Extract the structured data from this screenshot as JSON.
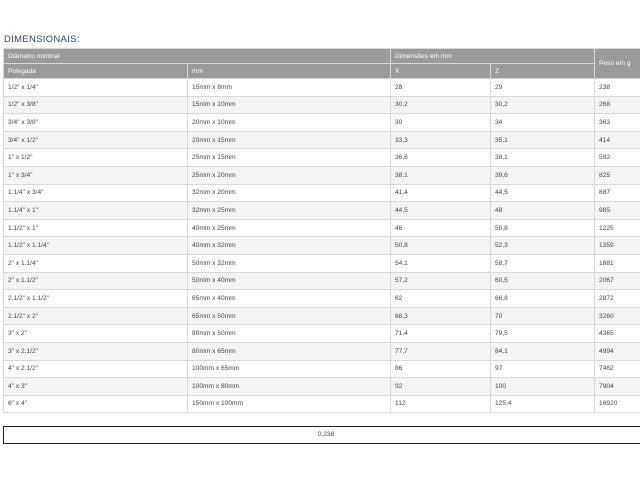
{
  "title": "DIMENSIONAIS:",
  "headers": {
    "diametro": "Diâmetro nominal",
    "dimensoes": "Dimensões em mm",
    "peso": "Peso em g",
    "polegada": "Polegada",
    "mm": "mm",
    "x": "X",
    "z": "Z"
  },
  "rows": [
    {
      "pol": "1/2\" x 1/4\"",
      "mm": "15mm x 8mm",
      "x": "28",
      "z": "29",
      "peso": "238"
    },
    {
      "pol": "1/2\" x 3/8\"",
      "mm": "15mm x 10mm",
      "x": "30,2",
      "z": "30,2",
      "peso": "268"
    },
    {
      "pol": "3/4\" x 3/8\"",
      "mm": "20mm x 10mm",
      "x": "30",
      "z": "34",
      "peso": "363"
    },
    {
      "pol": "3/4\" x 1/2\"",
      "mm": "20mm x 15mm",
      "x": "33,3",
      "z": "35,1",
      "peso": "414"
    },
    {
      "pol": "1\" x 1/2\"",
      "mm": "25mm x 15mm",
      "x": "36,6",
      "z": "38,1",
      "peso": "592"
    },
    {
      "pol": "1\" x 3/4\"",
      "mm": "25mm x 20mm",
      "x": "38,1",
      "z": "39,6",
      "peso": "825"
    },
    {
      "pol": "1.1/4\" x 3/4\"",
      "mm": "32mm x 20mm",
      "x": "41,4",
      "z": "44,5",
      "peso": "887"
    },
    {
      "pol": "1.1/4\" x 1\"",
      "mm": "32mm x 25mm",
      "x": "44,5",
      "z": "48",
      "peso": "985"
    },
    {
      "pol": "1.1/2\" x 1\"",
      "mm": "40mm x 25mm",
      "x": "46",
      "z": "50,8",
      "peso": "1225"
    },
    {
      "pol": "1.1/2\" x 1.1/4\"",
      "mm": "40mm x 32mm",
      "x": "50,8",
      "z": "52,3",
      "peso": "1359"
    },
    {
      "pol": "2\" x 1.1/4\"",
      "mm": "50mm x 32mm",
      "x": "54,1",
      "z": "58,7",
      "peso": "1881"
    },
    {
      "pol": "2\" x 1.1/2\"",
      "mm": "50mm x 40mm",
      "x": "57,2",
      "z": "60,5",
      "peso": "2067"
    },
    {
      "pol": "2.1/2\" x 1.1/2\"",
      "mm": "65mm x 40mm",
      "x": "62",
      "z": "66,8",
      "peso": "2872"
    },
    {
      "pol": "2.1/2\" x 2\"",
      "mm": "65mm x 50mm",
      "x": "68,3",
      "z": "70",
      "peso": "3260"
    },
    {
      "pol": "3\" x 2\"",
      "mm": "80mm x 50mm",
      "x": "71,4",
      "z": "79,5",
      "peso": "4365"
    },
    {
      "pol": "3\" x 2.1/2\"",
      "mm": "80mm x 65mm",
      "x": "77,7",
      "z": "84,1",
      "peso": "4994"
    },
    {
      "pol": "4\" x 2.1/2\"",
      "mm": "100mm x 65mm",
      "x": "86",
      "z": "97",
      "peso": "7462"
    },
    {
      "pol": "4\" x 3\"",
      "mm": "100mm x 80mm",
      "x": "92",
      "z": "100",
      "peso": "7904"
    },
    {
      "pol": "6\" x 4\"",
      "mm": "150mm x 100mm",
      "x": "112",
      "z": "125,4",
      "peso": "16920"
    }
  ],
  "footer_value": "0,238"
}
